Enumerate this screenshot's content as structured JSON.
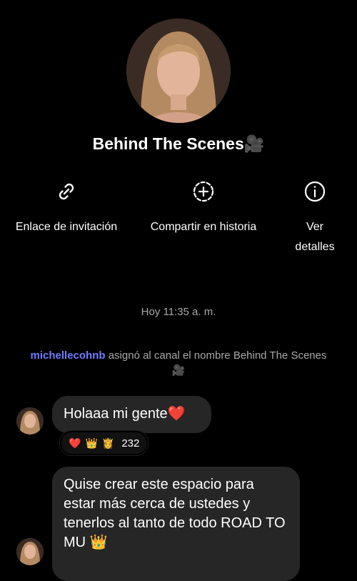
{
  "channel": {
    "title": "Behind The Scenes🎥"
  },
  "actions": {
    "invite_link": "Enlace de invitación",
    "share_story": "Compartir en historia",
    "view_details_line1": "Ver",
    "view_details_line2": "detalles"
  },
  "timestamp": "Hoy 11:35 a. m.",
  "system_message": {
    "user": "michellecohnb",
    "text": " asignó al canal el nombre Behind The Scenes🎥"
  },
  "messages": [
    {
      "text": "Holaaa mi gente❤️"
    },
    {
      "text": "Quise crear este espacio para estar más cerca de ustedes y tenerlos al tanto de todo ROAD TO MU 👑"
    }
  ],
  "reactions": {
    "emojis": [
      "❤️",
      "👑",
      "👸"
    ],
    "count": "232"
  },
  "colors": {
    "background": "#000000",
    "bubble": "#262626",
    "username": "#6f7dff",
    "muted": "#a8a8a8"
  }
}
